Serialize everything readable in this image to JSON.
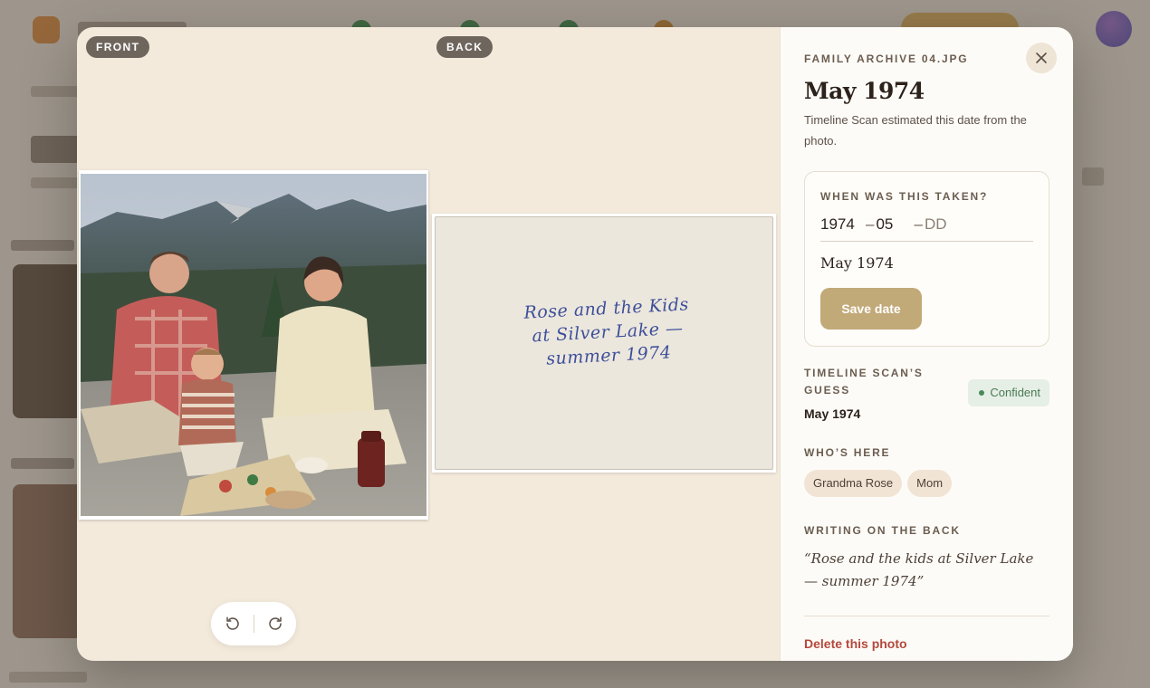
{
  "modal": {
    "labels": {
      "front": "FRONT",
      "back": "BACK"
    },
    "back_writing_lines": [
      "Rose and the Kids",
      "at Silver Lake —",
      "summer 1974"
    ]
  },
  "sidebar": {
    "filename": "FAMILY ARCHIVE 04.JPG",
    "date_title": "May 1974",
    "estimate_note": "Timeline Scan estimated this date from the photo.",
    "when_card": {
      "heading": "WHEN WAS THIS TAKEN?",
      "year": "1974",
      "month": "05",
      "day_placeholder": "DD",
      "formatted": "May 1974",
      "save_label": "Save date"
    },
    "guess": {
      "heading": "TIMELINE SCAN’S GUESS",
      "value": "May 1974",
      "badge": "Confident"
    },
    "people": {
      "heading": "WHO’S HERE",
      "chips": [
        "Grandma Rose",
        "Mom"
      ]
    },
    "back_writing": {
      "heading": "WRITING ON THE BACK",
      "text": "“Rose and the kids at Silver Lake — summer 1974”"
    },
    "delete_label": "Delete this photo"
  },
  "colors": {
    "accent": "#c2a978",
    "danger": "#b5483c",
    "confident": "#4a7a55"
  }
}
